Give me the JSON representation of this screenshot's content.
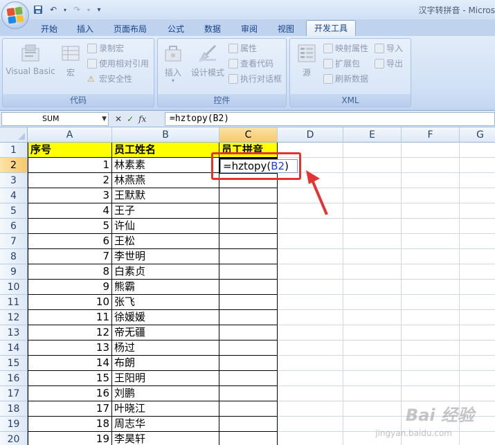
{
  "window": {
    "title": "汉字转拼音 - Micros"
  },
  "qat": {
    "save_icon": "save-icon",
    "undo_icon": "undo-icon",
    "redo_icon": "redo-icon",
    "more": "▾"
  },
  "tabs": [
    {
      "label": "开始"
    },
    {
      "label": "插入"
    },
    {
      "label": "页面布局"
    },
    {
      "label": "公式"
    },
    {
      "label": "数据"
    },
    {
      "label": "审阅"
    },
    {
      "label": "视图"
    },
    {
      "label": "开发工具",
      "active": true
    }
  ],
  "ribbon": {
    "code_group": {
      "label": "代码",
      "visual_basic": "Visual Basic",
      "macros": "宏",
      "record_macro": "录制宏",
      "relative_ref": "使用相对引用",
      "macro_security": "宏安全性"
    },
    "controls_group": {
      "label": "控件",
      "insert": "插入",
      "design_mode": "设计模式",
      "properties": "属性",
      "view_code": "查看代码",
      "run_dialog": "执行对话框"
    },
    "xml_group": {
      "label": "XML",
      "source": "源",
      "map_properties": "映射属性",
      "expansion_packs": "扩展包",
      "refresh_data": "刷新数据",
      "import": "导入",
      "export": "导出"
    }
  },
  "formula_bar": {
    "name_box": "SUM",
    "formula": "=hztopy(B2)"
  },
  "columns": [
    "A",
    "B",
    "C",
    "D",
    "E",
    "F",
    "G"
  ],
  "header_row": {
    "a": "序号",
    "b": "员工姓名",
    "c": "员工拼音"
  },
  "rows": [
    {
      "r": "2",
      "a": "1",
      "b": "林素素"
    },
    {
      "r": "3",
      "a": "2",
      "b": "林燕燕"
    },
    {
      "r": "4",
      "a": "3",
      "b": "王默默"
    },
    {
      "r": "5",
      "a": "4",
      "b": "王子"
    },
    {
      "r": "6",
      "a": "5",
      "b": "许仙"
    },
    {
      "r": "7",
      "a": "6",
      "b": "王松"
    },
    {
      "r": "8",
      "a": "7",
      "b": "李世明"
    },
    {
      "r": "9",
      "a": "8",
      "b": "白素贞"
    },
    {
      "r": "10",
      "a": "9",
      "b": "熊霸"
    },
    {
      "r": "11",
      "a": "10",
      "b": "张飞"
    },
    {
      "r": "12",
      "a": "11",
      "b": "徐媛媛"
    },
    {
      "r": "13",
      "a": "12",
      "b": "帝无疆"
    },
    {
      "r": "14",
      "a": "13",
      "b": "杨过"
    },
    {
      "r": "15",
      "a": "14",
      "b": "布朗"
    },
    {
      "r": "16",
      "a": "15",
      "b": "王阳明"
    },
    {
      "r": "17",
      "a": "16",
      "b": "刘鹏"
    },
    {
      "r": "18",
      "a": "17",
      "b": "叶晓江"
    },
    {
      "r": "19",
      "a": "18",
      "b": "周志华"
    },
    {
      "r": "20",
      "a": "19",
      "b": "李昊轩"
    }
  ],
  "edit": {
    "prefix": "=hztopy(",
    "ref": "B2",
    "suffix": ")"
  },
  "watermark": {
    "brand": "Bai 经验",
    "url": "jingyan.baidu.com"
  },
  "colors": {
    "header_fill": "#ffff00",
    "annotation": "#e53333",
    "ribbon": "#dbe7f7"
  }
}
